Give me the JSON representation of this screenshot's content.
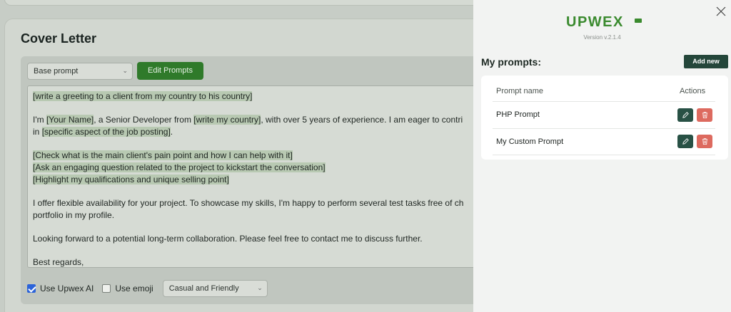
{
  "cover_letter": {
    "title": "Cover Letter",
    "base_prompt_select": "Base prompt",
    "edit_prompts_label": "Edit Prompts",
    "text": {
      "p1": "[write a greeting to a client from my country to his country]",
      "p2_a": "I'm ",
      "p2_b": "[Your Name]",
      "p2_c": ", a Senior Developer from ",
      "p2_d": "[write my country]",
      "p2_e": ", with over 5 years of experience. I am eager to contri",
      "p2_f": "in ",
      "p2_g": "[specific aspect of the job posting]",
      "p2_h": ".",
      "p3_a": "[Check what is the main client's pain point and how I can help with it]",
      "p3_b": "[Ask an engaging question related to the project to kickstart the conversation]",
      "p3_c": "[Highlight my qualifications and unique selling point]",
      "p4_a": "I offer flexible availability for your project. To showcase my skills, I'm happy to perform several test tasks free of ch",
      "p4_b": "portfolio in my profile.",
      "p5": "Looking forward to a potential long-term collaboration. Please feel free to contact me to discuss further.",
      "p6": "Best regards,"
    },
    "use_ai_label": "Use Upwex AI",
    "use_ai_checked": true,
    "use_emoji_label": "Use emoji",
    "use_emoji_checked": false,
    "tone_select": "Casual and Friendly"
  },
  "panel": {
    "logo_text": "UPWEX",
    "version": "Version v.2.1.4",
    "title": "My prompts:",
    "add_new_label": "Add new",
    "table": {
      "col_name": "Prompt name",
      "col_actions": "Actions",
      "rows": [
        {
          "name": "PHP Prompt"
        },
        {
          "name": "My Custom Prompt"
        }
      ]
    },
    "icons": [
      "close-icon",
      "pencil-icon",
      "trash-icon",
      "chevron-down-icon",
      "checkmark-icon"
    ]
  },
  "colors": {
    "accent_dark_green": "#24463a",
    "edit_button": "#285145",
    "delete_button": "#dd6a5f",
    "edit_prompts_button": "#2f7a2a",
    "logo_green": "#3a8a2e"
  }
}
